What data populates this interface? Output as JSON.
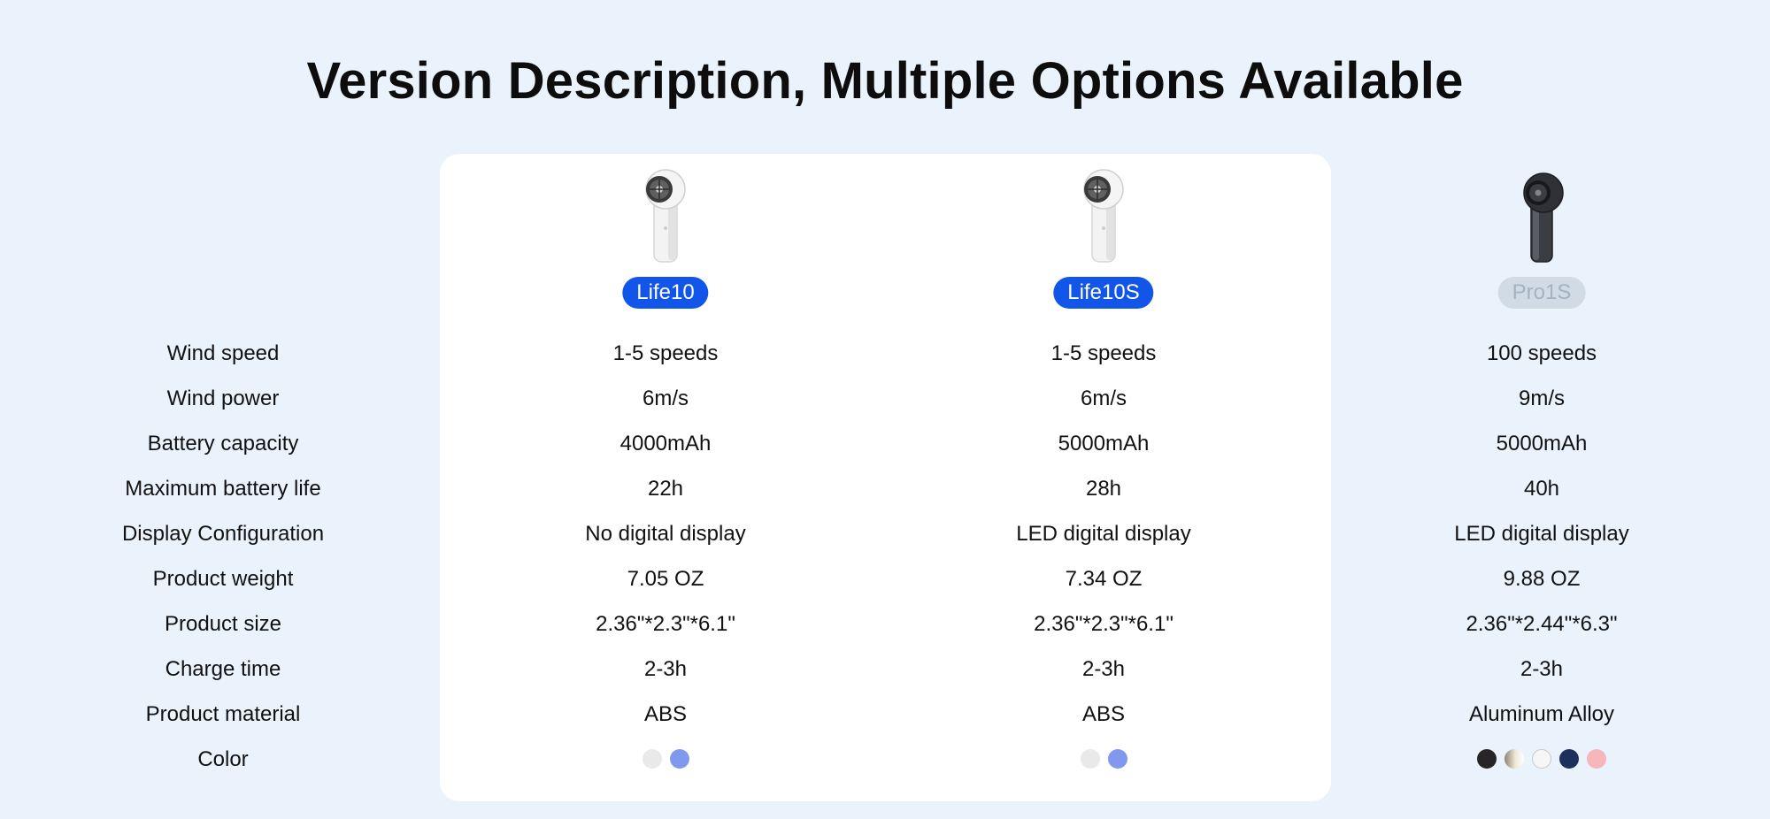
{
  "page": {
    "title": "Version Description, Multiple Options Available",
    "background_color": "#eaf3fc"
  },
  "row_labels": [
    "Wind speed",
    "Wind power",
    "Battery capacity",
    "Maximum battery life",
    "Display Configuration",
    "Product weight",
    "Product size",
    "Charge time",
    "Product material",
    "Color"
  ],
  "products": [
    {
      "name": "Life10",
      "badge_color": "#1156e8",
      "badge_text_color": "#ffffff",
      "image_icon": "handheld-fan-white-icon",
      "specs": [
        "1-5 speeds",
        "6m/s",
        "4000mAh",
        "22h",
        "No digital display",
        "7.05 OZ",
        "2.36\"*2.3\"*6.1\"",
        "2-3h",
        "ABS"
      ],
      "colors": [
        "#e9e9e9",
        "#8099ee"
      ]
    },
    {
      "name": "Life10S",
      "badge_color": "#1156e8",
      "badge_text_color": "#ffffff",
      "image_icon": "handheld-fan-white-icon",
      "specs": [
        "1-5 speeds",
        "6m/s",
        "5000mAh",
        "28h",
        "LED digital display",
        "7.34 OZ",
        "2.36\"*2.3\"*6.1\"",
        "2-3h",
        "ABS"
      ],
      "colors": [
        "#e9e9e9",
        "#8099ee"
      ]
    },
    {
      "name": "Pro1S",
      "badge_color": "#d1dbe6",
      "badge_text_color": "#a4b2c2",
      "image_icon": "handheld-fan-dark-icon",
      "specs": [
        "100 speeds",
        "9m/s",
        "5000mAh",
        "40h",
        "LED digital display",
        "9.88 OZ",
        "2.36\"*2.44\"*6.3\"",
        "2-3h",
        "Aluminum Alloy"
      ],
      "colors": [
        "#262626",
        "#c9b69b",
        "#f6f6f6",
        "#1d2f5c",
        "#f7b6bc"
      ]
    }
  ]
}
